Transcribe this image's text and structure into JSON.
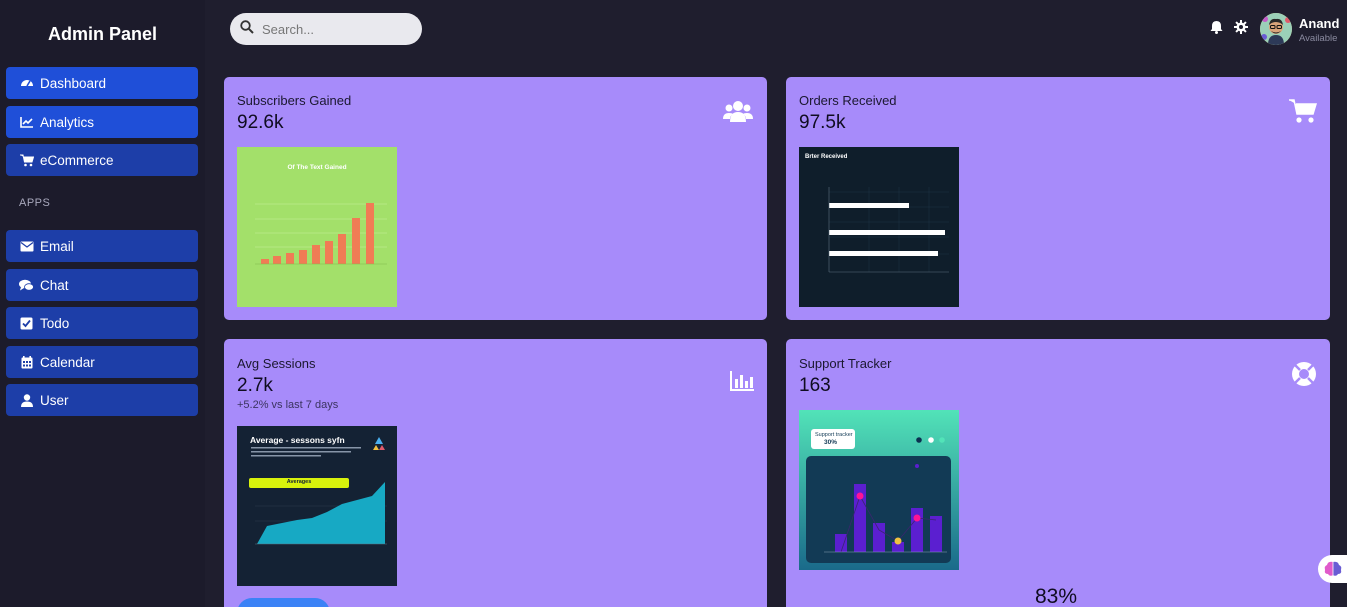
{
  "sidebar": {
    "brand": "Admin Panel",
    "items": [
      {
        "label": "Dashboard",
        "icon": "dashboard-icon"
      },
      {
        "label": "Analytics",
        "icon": "analytics-icon"
      },
      {
        "label": "eCommerce",
        "icon": "cart-icon"
      }
    ],
    "apps_label": "APPS",
    "apps": [
      {
        "label": "Email",
        "icon": "envelope-icon"
      },
      {
        "label": "Chat",
        "icon": "chat-icon"
      },
      {
        "label": "Todo",
        "icon": "checkbox-icon"
      },
      {
        "label": "Calendar",
        "icon": "calendar-icon"
      },
      {
        "label": "User",
        "icon": "user-icon"
      }
    ]
  },
  "topbar": {
    "search_placeholder": "Search...",
    "user_name": "Anand",
    "user_status": "Available"
  },
  "cards": {
    "subscribers": {
      "title": "Subscribers Gained",
      "value": "92.6k",
      "icon": "users-icon",
      "chart_title": "Of The Text Gained"
    },
    "orders": {
      "title": "Orders Received",
      "value": "97.5k",
      "icon": "cart-icon",
      "chart_title": "Brter Received"
    },
    "sessions": {
      "title": "Avg Sessions",
      "value": "2.7k",
      "sub": "+5.2% vs last 7 days",
      "icon": "bar-chart-icon",
      "chart_title": "Average - sessons syfn",
      "chart_pill": "Averages"
    },
    "support": {
      "title": "Support Tracker",
      "value": "163",
      "icon": "lifebuoy-icon",
      "bubble_title": "Support tracker",
      "bubble_value": "30%",
      "percent": "83%"
    }
  },
  "colors": {
    "background": "#1f1e2e",
    "card": "#a78bfa",
    "nav": "#1d3ea8",
    "nav_active": "#1f4fd8",
    "bar_orange": "#f07c55",
    "thumb_green": "#a3e06a"
  }
}
